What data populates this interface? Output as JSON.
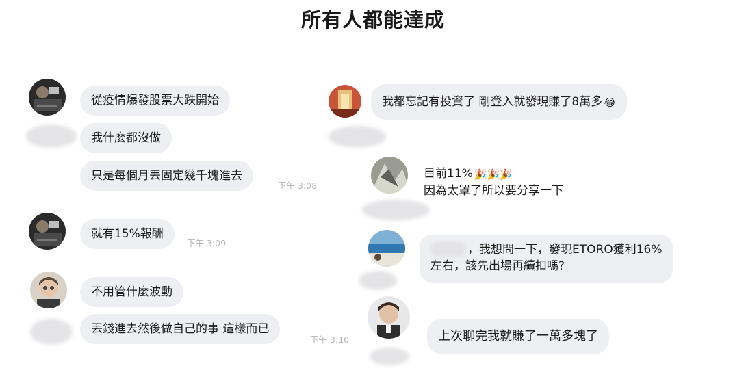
{
  "title": "所有人都能達成",
  "left": {
    "messages": [
      "從疫情爆發股票大跌開始",
      "我什麼都沒做",
      "只是每個月丟固定幾千塊進去",
      "就有15%報酬",
      "不用管什麼波動",
      "丟錢進去然後做自己的事 這樣而已"
    ],
    "times": [
      "下午 3:08",
      "下午 3:09",
      "下午 3:10"
    ]
  },
  "right": {
    "msg1": "我都忘記有投資了 剛登入就發現賺了8萬多",
    "msg1_emoji": "😂",
    "msg2_line1": "目前11%",
    "msg2_emoji": "🎉🎉🎉",
    "msg2_line2": "因為太罩了所以要分享一下",
    "msg3_line1": "，我想問一下，發現ETORO獲利16%",
    "msg3_line2": "左右，該先出場再續扣嗎?",
    "msg4": "上次聊完我就賺了一萬多塊了"
  }
}
